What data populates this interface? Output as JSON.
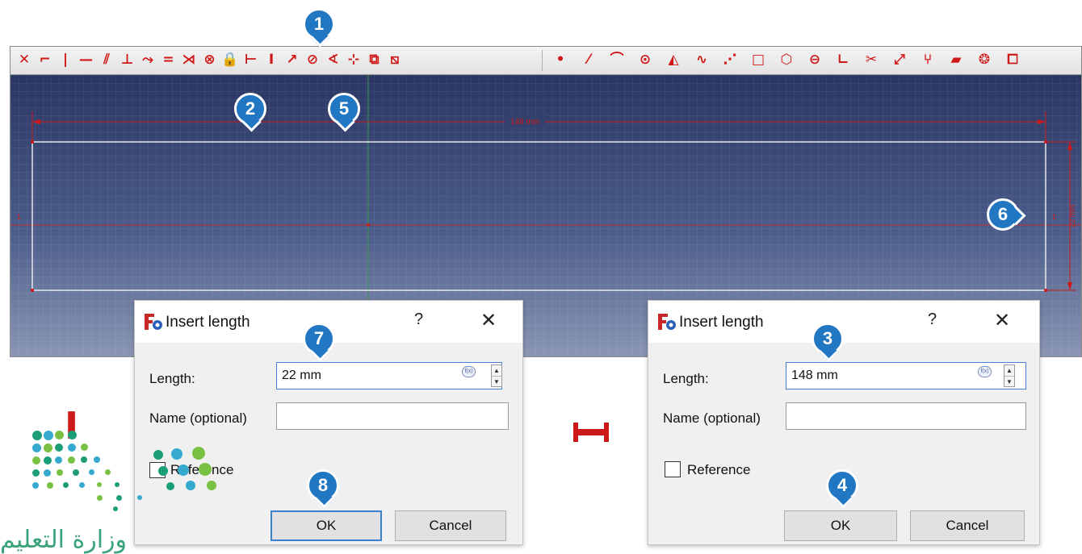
{
  "toolbar": {
    "left_group": [
      {
        "icon": "constrain-coincident-icon",
        "glyph": "✕"
      },
      {
        "icon": "constrain-point-on-object-icon",
        "glyph": "⌐"
      },
      {
        "icon": "constrain-vertical-icon",
        "glyph": "|"
      },
      {
        "icon": "constrain-horizontal-icon",
        "glyph": "—"
      },
      {
        "icon": "constrain-parallel-icon",
        "glyph": "⫽"
      },
      {
        "icon": "constrain-perpendicular-icon",
        "glyph": "⊥"
      },
      {
        "icon": "constrain-tangent-icon",
        "glyph": "⤳"
      },
      {
        "icon": "constrain-equal-icon",
        "glyph": "="
      },
      {
        "icon": "constrain-symmetric-icon",
        "glyph": "⋊"
      },
      {
        "icon": "constrain-block-icon",
        "glyph": "⊗"
      },
      {
        "icon": "constrain-lock-icon",
        "glyph": "🔒"
      },
      {
        "icon": "constrain-horizontal-distance-icon",
        "glyph": "⊢"
      },
      {
        "icon": "constrain-vertical-distance-icon",
        "glyph": "I"
      },
      {
        "icon": "constrain-distance-icon",
        "glyph": "↗"
      },
      {
        "icon": "constrain-radius-icon",
        "glyph": "⊘"
      },
      {
        "icon": "constrain-angle-icon",
        "glyph": "∢"
      },
      {
        "icon": "constrain-snell-icon",
        "glyph": "⊹"
      },
      {
        "icon": "toggle-driving-icon",
        "glyph": "⧉"
      },
      {
        "icon": "toggle-active-icon",
        "glyph": "⧅"
      }
    ],
    "right_group": [
      {
        "icon": "create-point-icon",
        "glyph": "•"
      },
      {
        "icon": "create-line-icon",
        "glyph": "⁄"
      },
      {
        "icon": "create-arc-icon",
        "glyph": "⌒"
      },
      {
        "icon": "create-circle-icon",
        "glyph": "⊙"
      },
      {
        "icon": "create-conic-icon",
        "glyph": "◭"
      },
      {
        "icon": "create-bspline-icon",
        "glyph": "∿"
      },
      {
        "icon": "create-polyline-icon",
        "glyph": "⋰"
      },
      {
        "icon": "create-rectangle-icon",
        "glyph": "□"
      },
      {
        "icon": "create-polygon-icon",
        "glyph": "⬡"
      },
      {
        "icon": "create-slot-icon",
        "glyph": "⊖"
      },
      {
        "icon": "create-fillet-icon",
        "glyph": "∟"
      },
      {
        "icon": "trim-icon",
        "glyph": "✂"
      },
      {
        "icon": "extend-icon",
        "glyph": "⤢"
      },
      {
        "icon": "split-icon",
        "glyph": "⑂"
      },
      {
        "icon": "external-geometry-icon",
        "glyph": "▰"
      },
      {
        "icon": "carbon-copy-icon",
        "glyph": "❂"
      },
      {
        "icon": "construction-mode-icon",
        "glyph": "⧠"
      }
    ]
  },
  "viewport": {
    "horizontal_dimension_label": "148 mm",
    "vertical_dimension_label": "22 mm",
    "edge_label_left": "1",
    "edge_label_right": "1"
  },
  "dialog_left": {
    "title": "Insert length",
    "help": "?",
    "close": "✕",
    "length_label": "Length:",
    "length_value": "22 mm",
    "name_label": "Name (optional)",
    "name_value": "",
    "reference_label": "Reference",
    "ok": "OK",
    "cancel": "Cancel"
  },
  "dialog_right": {
    "title": "Insert length",
    "help": "?",
    "close": "✕",
    "length_label": "Length:",
    "length_value": "148 mm",
    "name_label": "Name (optional)",
    "name_value": "",
    "reference_label": "Reference",
    "ok": "OK",
    "cancel": "Cancel"
  },
  "callouts": [
    "1",
    "2",
    "3",
    "4",
    "5",
    "6",
    "7",
    "8"
  ],
  "symbols": {
    "vertical_distance": "I",
    "horizontal_distance": "⊢⊣"
  },
  "logo": {
    "text": "وزارة التعليم",
    "colors": [
      "#1b9e77",
      "#36a9cf",
      "#7ac143"
    ]
  },
  "colors": {
    "accent": "#2277c2",
    "constraint_red": "#d01818",
    "viewport_top": "#2a3563",
    "viewport_bottom": "#8a96b3"
  }
}
